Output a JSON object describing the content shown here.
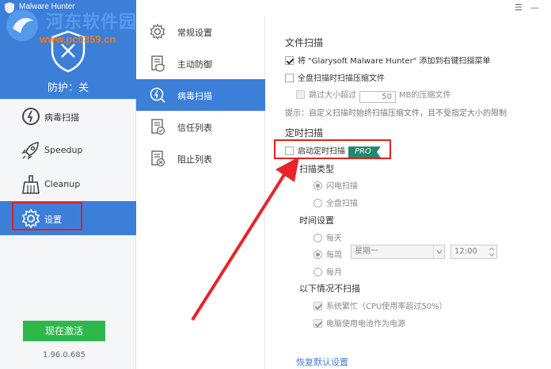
{
  "window": {
    "title": "Malware Hunter"
  },
  "watermark": {
    "line1": "河东软件园",
    "line2": "www.pc0359.cn"
  },
  "protection": {
    "status": "防护：关"
  },
  "sidebar": {
    "items": [
      {
        "label": "病毒扫描",
        "icon": "virus-scan-icon"
      },
      {
        "label": "Speedup",
        "icon": "rocket-icon"
      },
      {
        "label": "Cleanup",
        "icon": "broom-icon"
      },
      {
        "label": "设置",
        "icon": "gear-icon"
      }
    ],
    "activate_label": "现在激活",
    "version": "1.96.0.685"
  },
  "tabs": [
    {
      "label": "常规设置",
      "icon": "gear-icon"
    },
    {
      "label": "主动防御",
      "icon": "shield-doc-icon"
    },
    {
      "label": "病毒扫描",
      "icon": "scan-icon"
    },
    {
      "label": "信任列表",
      "icon": "trust-list-icon"
    },
    {
      "label": "阻止列表",
      "icon": "block-list-icon"
    }
  ],
  "file_scan": {
    "heading": "文件扫描",
    "context_menu": "将 \"Glarysoft Malware Hunter\" 添加到右键扫描菜单",
    "scan_archives": "全盘扫描时扫描压缩文件",
    "skip_prefix": "跳过大小超过",
    "skip_value": "50",
    "skip_suffix": "MB的压缩文件",
    "hint": "提示：自定义扫描时始终扫描压缩文件，且不受指定大小的限制"
  },
  "schedule": {
    "heading": "定时扫描",
    "enable_label": "启动定时扫描",
    "pro_badge": "PRO",
    "scan_type_heading": "扫描类型",
    "quick_scan": "闪电扫描",
    "full_scan": "全盘扫描",
    "time_heading": "时间设置",
    "daily": "每天",
    "weekly": "每周",
    "weekday_value": "星期一",
    "time_value": "12:00",
    "monthly": "每月",
    "skip_heading": "以下情况不扫描",
    "skip_busy": "系统繁忙（CPU使用率超过50%）",
    "skip_battery": "电脑使用电池作为电源"
  },
  "restore_defaults": "恢复默认设置",
  "colors": {
    "accent": "#3c7fd9",
    "highlight": "#e02020",
    "activate": "#2eb84b",
    "pro": "#1f8a6e"
  }
}
